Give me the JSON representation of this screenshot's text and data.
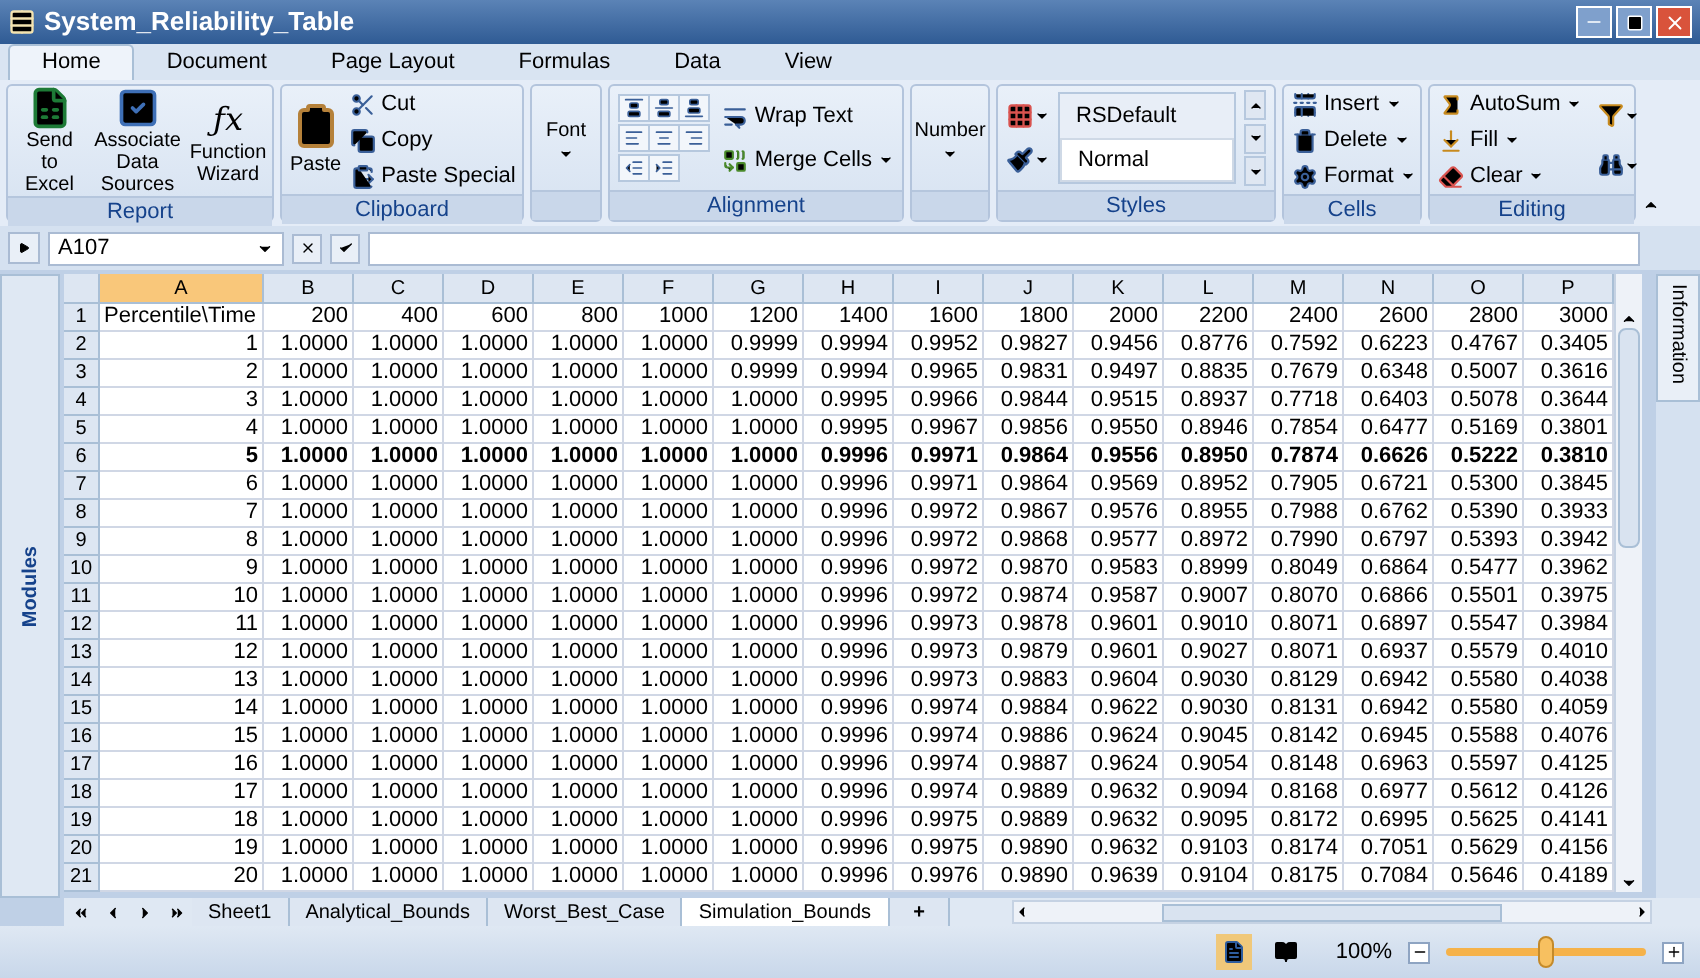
{
  "window": {
    "title": "System_Reliability_Table"
  },
  "ribbon_tabs": [
    {
      "label": "Home",
      "selected": true
    },
    {
      "label": "Document",
      "selected": false
    },
    {
      "label": "Page Layout",
      "selected": false
    },
    {
      "label": "Formulas",
      "selected": false
    },
    {
      "label": "Data",
      "selected": false
    },
    {
      "label": "View",
      "selected": false
    }
  ],
  "report": {
    "label": "Report",
    "buttons": [
      "Send to Excel",
      "Associate Data Sources",
      "Function Wizard"
    ],
    "function_icon": "ƒx"
  },
  "clipboard": {
    "label": "Clipboard",
    "paste": "Paste",
    "items": [
      "Cut",
      "Copy",
      "Paste Special"
    ]
  },
  "font": {
    "label": "Font"
  },
  "alignment": {
    "label": "Alignment",
    "items": [
      "Wrap Text",
      "Merge Cells"
    ]
  },
  "number": {
    "label": "Number"
  },
  "styles": {
    "label": "Styles",
    "items": [
      {
        "label": "RSDefault",
        "selected": false
      },
      {
        "label": "Normal",
        "selected": true
      }
    ]
  },
  "cells_group": {
    "label": "Cells",
    "items": [
      "Insert",
      "Delete",
      "Format"
    ]
  },
  "editing": {
    "label": "Editing",
    "items": [
      "AutoSum",
      "Fill",
      "Clear"
    ]
  },
  "name_box": {
    "value": "A107"
  },
  "side_panels": {
    "left": "Modules",
    "right": "Information"
  },
  "columns": [
    {
      "label": "A",
      "selected": true
    },
    {
      "label": "B",
      "selected": false
    },
    {
      "label": "C",
      "selected": false
    },
    {
      "label": "D",
      "selected": false
    },
    {
      "label": "E",
      "selected": false
    },
    {
      "label": "F",
      "selected": false
    },
    {
      "label": "G",
      "selected": false
    },
    {
      "label": "H",
      "selected": false
    },
    {
      "label": "I",
      "selected": false
    },
    {
      "label": "J",
      "selected": false
    },
    {
      "label": "K",
      "selected": false
    },
    {
      "label": "L",
      "selected": false
    },
    {
      "label": "M",
      "selected": false
    },
    {
      "label": "N",
      "selected": false
    },
    {
      "label": "O",
      "selected": false
    },
    {
      "label": "P",
      "selected": false
    }
  ],
  "rows": [
    {
      "number": "1",
      "kind": "heading",
      "bold": false,
      "cells": [
        "Percentile\\Time",
        "200",
        "400",
        "600",
        "800",
        "1000",
        "1200",
        "1400",
        "1600",
        "1800",
        "2000",
        "2200",
        "2400",
        "2600",
        "2800",
        "3000"
      ]
    },
    {
      "number": "2",
      "kind": "data",
      "bold": false,
      "cells": [
        "1",
        "1.0000",
        "1.0000",
        "1.0000",
        "1.0000",
        "1.0000",
        "0.9999",
        "0.9994",
        "0.9952",
        "0.9827",
        "0.9456",
        "0.8776",
        "0.7592",
        "0.6223",
        "0.4767",
        "0.3405"
      ]
    },
    {
      "number": "3",
      "kind": "data",
      "bold": false,
      "cells": [
        "2",
        "1.0000",
        "1.0000",
        "1.0000",
        "1.0000",
        "1.0000",
        "0.9999",
        "0.9994",
        "0.9965",
        "0.9831",
        "0.9497",
        "0.8835",
        "0.7679",
        "0.6348",
        "0.5007",
        "0.3616"
      ]
    },
    {
      "number": "4",
      "kind": "data",
      "bold": false,
      "cells": [
        "3",
        "1.0000",
        "1.0000",
        "1.0000",
        "1.0000",
        "1.0000",
        "1.0000",
        "0.9995",
        "0.9966",
        "0.9844",
        "0.9515",
        "0.8937",
        "0.7718",
        "0.6403",
        "0.5078",
        "0.3644"
      ]
    },
    {
      "number": "5",
      "kind": "data",
      "bold": false,
      "cells": [
        "4",
        "1.0000",
        "1.0000",
        "1.0000",
        "1.0000",
        "1.0000",
        "1.0000",
        "0.9995",
        "0.9967",
        "0.9856",
        "0.9550",
        "0.8946",
        "0.7854",
        "0.6477",
        "0.5169",
        "0.3801"
      ]
    },
    {
      "number": "6",
      "kind": "data",
      "bold": true,
      "cells": [
        "5",
        "1.0000",
        "1.0000",
        "1.0000",
        "1.0000",
        "1.0000",
        "1.0000",
        "0.9996",
        "0.9971",
        "0.9864",
        "0.9556",
        "0.8950",
        "0.7874",
        "0.6626",
        "0.5222",
        "0.3810"
      ]
    },
    {
      "number": "7",
      "kind": "data",
      "bold": false,
      "cells": [
        "6",
        "1.0000",
        "1.0000",
        "1.0000",
        "1.0000",
        "1.0000",
        "1.0000",
        "0.9996",
        "0.9971",
        "0.9864",
        "0.9569",
        "0.8952",
        "0.7905",
        "0.6721",
        "0.5300",
        "0.3845"
      ]
    },
    {
      "number": "8",
      "kind": "data",
      "bold": false,
      "cells": [
        "7",
        "1.0000",
        "1.0000",
        "1.0000",
        "1.0000",
        "1.0000",
        "1.0000",
        "0.9996",
        "0.9972",
        "0.9867",
        "0.9576",
        "0.8955",
        "0.7988",
        "0.6762",
        "0.5390",
        "0.3933"
      ]
    },
    {
      "number": "9",
      "kind": "data",
      "bold": false,
      "cells": [
        "8",
        "1.0000",
        "1.0000",
        "1.0000",
        "1.0000",
        "1.0000",
        "1.0000",
        "0.9996",
        "0.9972",
        "0.9868",
        "0.9577",
        "0.8972",
        "0.7990",
        "0.6797",
        "0.5393",
        "0.3942"
      ]
    },
    {
      "number": "10",
      "kind": "data",
      "bold": false,
      "cells": [
        "9",
        "1.0000",
        "1.0000",
        "1.0000",
        "1.0000",
        "1.0000",
        "1.0000",
        "0.9996",
        "0.9972",
        "0.9870",
        "0.9583",
        "0.8999",
        "0.8049",
        "0.6864",
        "0.5477",
        "0.3962"
      ]
    },
    {
      "number": "11",
      "kind": "data",
      "bold": false,
      "cells": [
        "10",
        "1.0000",
        "1.0000",
        "1.0000",
        "1.0000",
        "1.0000",
        "1.0000",
        "0.9996",
        "0.9972",
        "0.9874",
        "0.9587",
        "0.9007",
        "0.8070",
        "0.6866",
        "0.5501",
        "0.3975"
      ]
    },
    {
      "number": "12",
      "kind": "data",
      "bold": false,
      "cells": [
        "11",
        "1.0000",
        "1.0000",
        "1.0000",
        "1.0000",
        "1.0000",
        "1.0000",
        "0.9996",
        "0.9973",
        "0.9878",
        "0.9601",
        "0.9010",
        "0.8071",
        "0.6897",
        "0.5547",
        "0.3984"
      ]
    },
    {
      "number": "13",
      "kind": "data",
      "bold": false,
      "cells": [
        "12",
        "1.0000",
        "1.0000",
        "1.0000",
        "1.0000",
        "1.0000",
        "1.0000",
        "0.9996",
        "0.9973",
        "0.9879",
        "0.9601",
        "0.9027",
        "0.8071",
        "0.6937",
        "0.5579",
        "0.4010"
      ]
    },
    {
      "number": "14",
      "kind": "data",
      "bold": false,
      "cells": [
        "13",
        "1.0000",
        "1.0000",
        "1.0000",
        "1.0000",
        "1.0000",
        "1.0000",
        "0.9996",
        "0.9973",
        "0.9883",
        "0.9604",
        "0.9030",
        "0.8129",
        "0.6942",
        "0.5580",
        "0.4038"
      ]
    },
    {
      "number": "15",
      "kind": "data",
      "bold": false,
      "cells": [
        "14",
        "1.0000",
        "1.0000",
        "1.0000",
        "1.0000",
        "1.0000",
        "1.0000",
        "0.9996",
        "0.9974",
        "0.9884",
        "0.9622",
        "0.9030",
        "0.8131",
        "0.6942",
        "0.5580",
        "0.4059"
      ]
    },
    {
      "number": "16",
      "kind": "data",
      "bold": false,
      "cells": [
        "15",
        "1.0000",
        "1.0000",
        "1.0000",
        "1.0000",
        "1.0000",
        "1.0000",
        "0.9996",
        "0.9974",
        "0.9886",
        "0.9624",
        "0.9045",
        "0.8142",
        "0.6945",
        "0.5588",
        "0.4076"
      ]
    },
    {
      "number": "17",
      "kind": "data",
      "bold": false,
      "cells": [
        "16",
        "1.0000",
        "1.0000",
        "1.0000",
        "1.0000",
        "1.0000",
        "1.0000",
        "0.9996",
        "0.9974",
        "0.9887",
        "0.9624",
        "0.9054",
        "0.8148",
        "0.6963",
        "0.5597",
        "0.4125"
      ]
    },
    {
      "number": "18",
      "kind": "data",
      "bold": false,
      "cells": [
        "17",
        "1.0000",
        "1.0000",
        "1.0000",
        "1.0000",
        "1.0000",
        "1.0000",
        "0.9996",
        "0.9974",
        "0.9889",
        "0.9632",
        "0.9094",
        "0.8168",
        "0.6977",
        "0.5612",
        "0.4126"
      ]
    },
    {
      "number": "19",
      "kind": "data",
      "bold": false,
      "cells": [
        "18",
        "1.0000",
        "1.0000",
        "1.0000",
        "1.0000",
        "1.0000",
        "1.0000",
        "0.9996",
        "0.9975",
        "0.9889",
        "0.9632",
        "0.9095",
        "0.8172",
        "0.6995",
        "0.5625",
        "0.4141"
      ]
    },
    {
      "number": "20",
      "kind": "data",
      "bold": false,
      "cells": [
        "19",
        "1.0000",
        "1.0000",
        "1.0000",
        "1.0000",
        "1.0000",
        "1.0000",
        "0.9996",
        "0.9975",
        "0.9890",
        "0.9632",
        "0.9103",
        "0.8174",
        "0.7051",
        "0.5629",
        "0.4156"
      ]
    },
    {
      "number": "21",
      "kind": "data",
      "bold": false,
      "cells": [
        "20",
        "1.0000",
        "1.0000",
        "1.0000",
        "1.0000",
        "1.0000",
        "1.0000",
        "0.9996",
        "0.9976",
        "0.9890",
        "0.9639",
        "0.9104",
        "0.8175",
        "0.7084",
        "0.5646",
        "0.4189"
      ]
    }
  ],
  "sheet_tabs": [
    {
      "label": "Sheet1",
      "selected": false
    },
    {
      "label": "Analytical_Bounds",
      "selected": false
    },
    {
      "label": "Worst_Best_Case",
      "selected": false
    },
    {
      "label": "Simulation_Bounds",
      "selected": true
    }
  ],
  "add_sheet": "+",
  "status_bar": {
    "zoom": "100%",
    "zoom_slider": {
      "level": 0.5
    }
  }
}
